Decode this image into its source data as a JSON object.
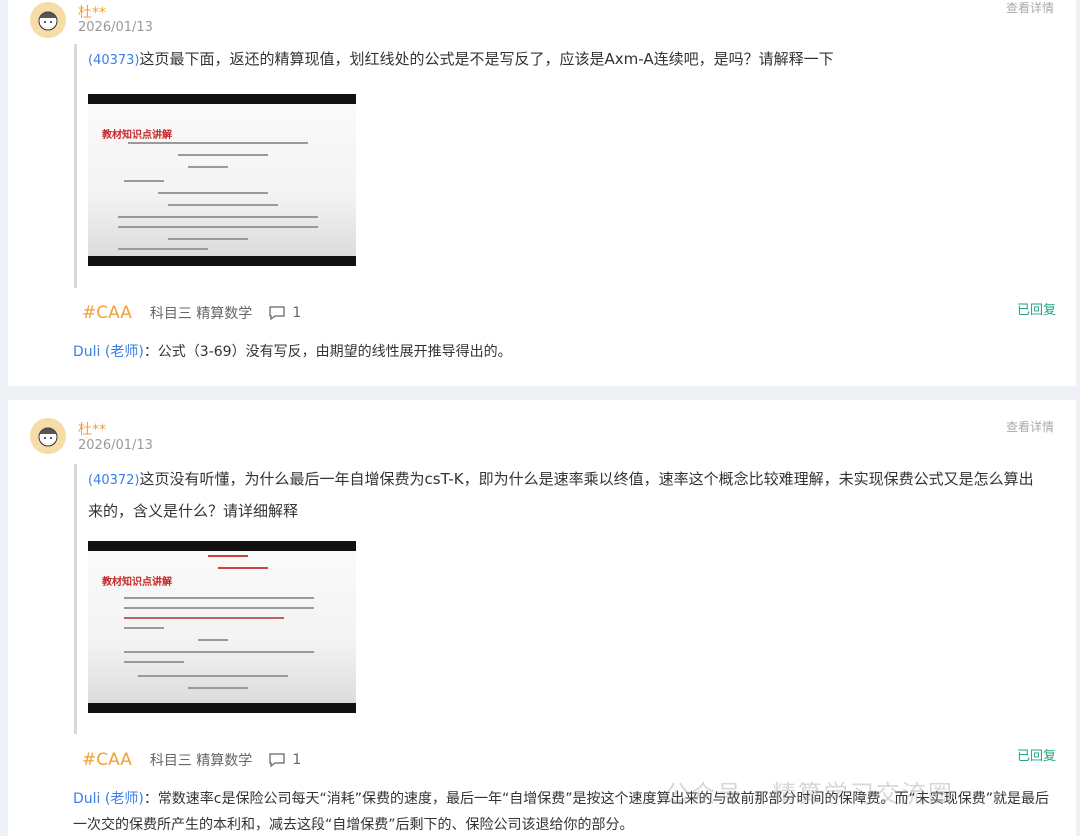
{
  "posts": [
    {
      "user": "杜**",
      "date": "2026/01/13",
      "detail_label": "查看详情",
      "question_id": "(40373)",
      "question_text": "这页最下面，返还的精算现值，划红线处的公式是不是写反了，应该是Axm-A连续吧，是吗？请解释一下",
      "image_caption": "教材知识点讲解",
      "tag": "#CAA",
      "subject": "科目三 精算数学",
      "comment_count": "1",
      "status": "已回复",
      "teacher_name": "Duli (老师)",
      "reply_text": "：公式（3-69）没有写反，由期望的线性展开推导得出的。"
    },
    {
      "user": "杜**",
      "date": "2026/01/13",
      "detail_label": "查看详情",
      "question_id": "(40372)",
      "question_text": "这页没有听懂，为什么最后一年自增保费为csT-K，即为什么是速率乘以终值，速率这个概念比较难理解，未实现保费公式又是怎么算出来的，含义是什么？请详细解释",
      "image_caption": "教材知识点讲解",
      "tag": "#CAA",
      "subject": "科目三 精算数学",
      "comment_count": "1",
      "status": "已回复",
      "teacher_name": "Duli (老师)",
      "reply_text": "：常数速率c是保险公司每天“消耗”保费的速度，最后一年“自增保费”是按这个速度算出来的与故前那部分时间的保障费。而“未实现保费”就是最后一次交的保费所产生的本利和，减去这段“自增保费”后剩下的、保险公司该退给你的部分。"
    }
  ],
  "watermark": "公众号 · 精算学习交流圈",
  "colors": {
    "accent_orange": "#f0a13a",
    "link_blue": "#3b7ee8",
    "replied_green": "#20a583"
  }
}
